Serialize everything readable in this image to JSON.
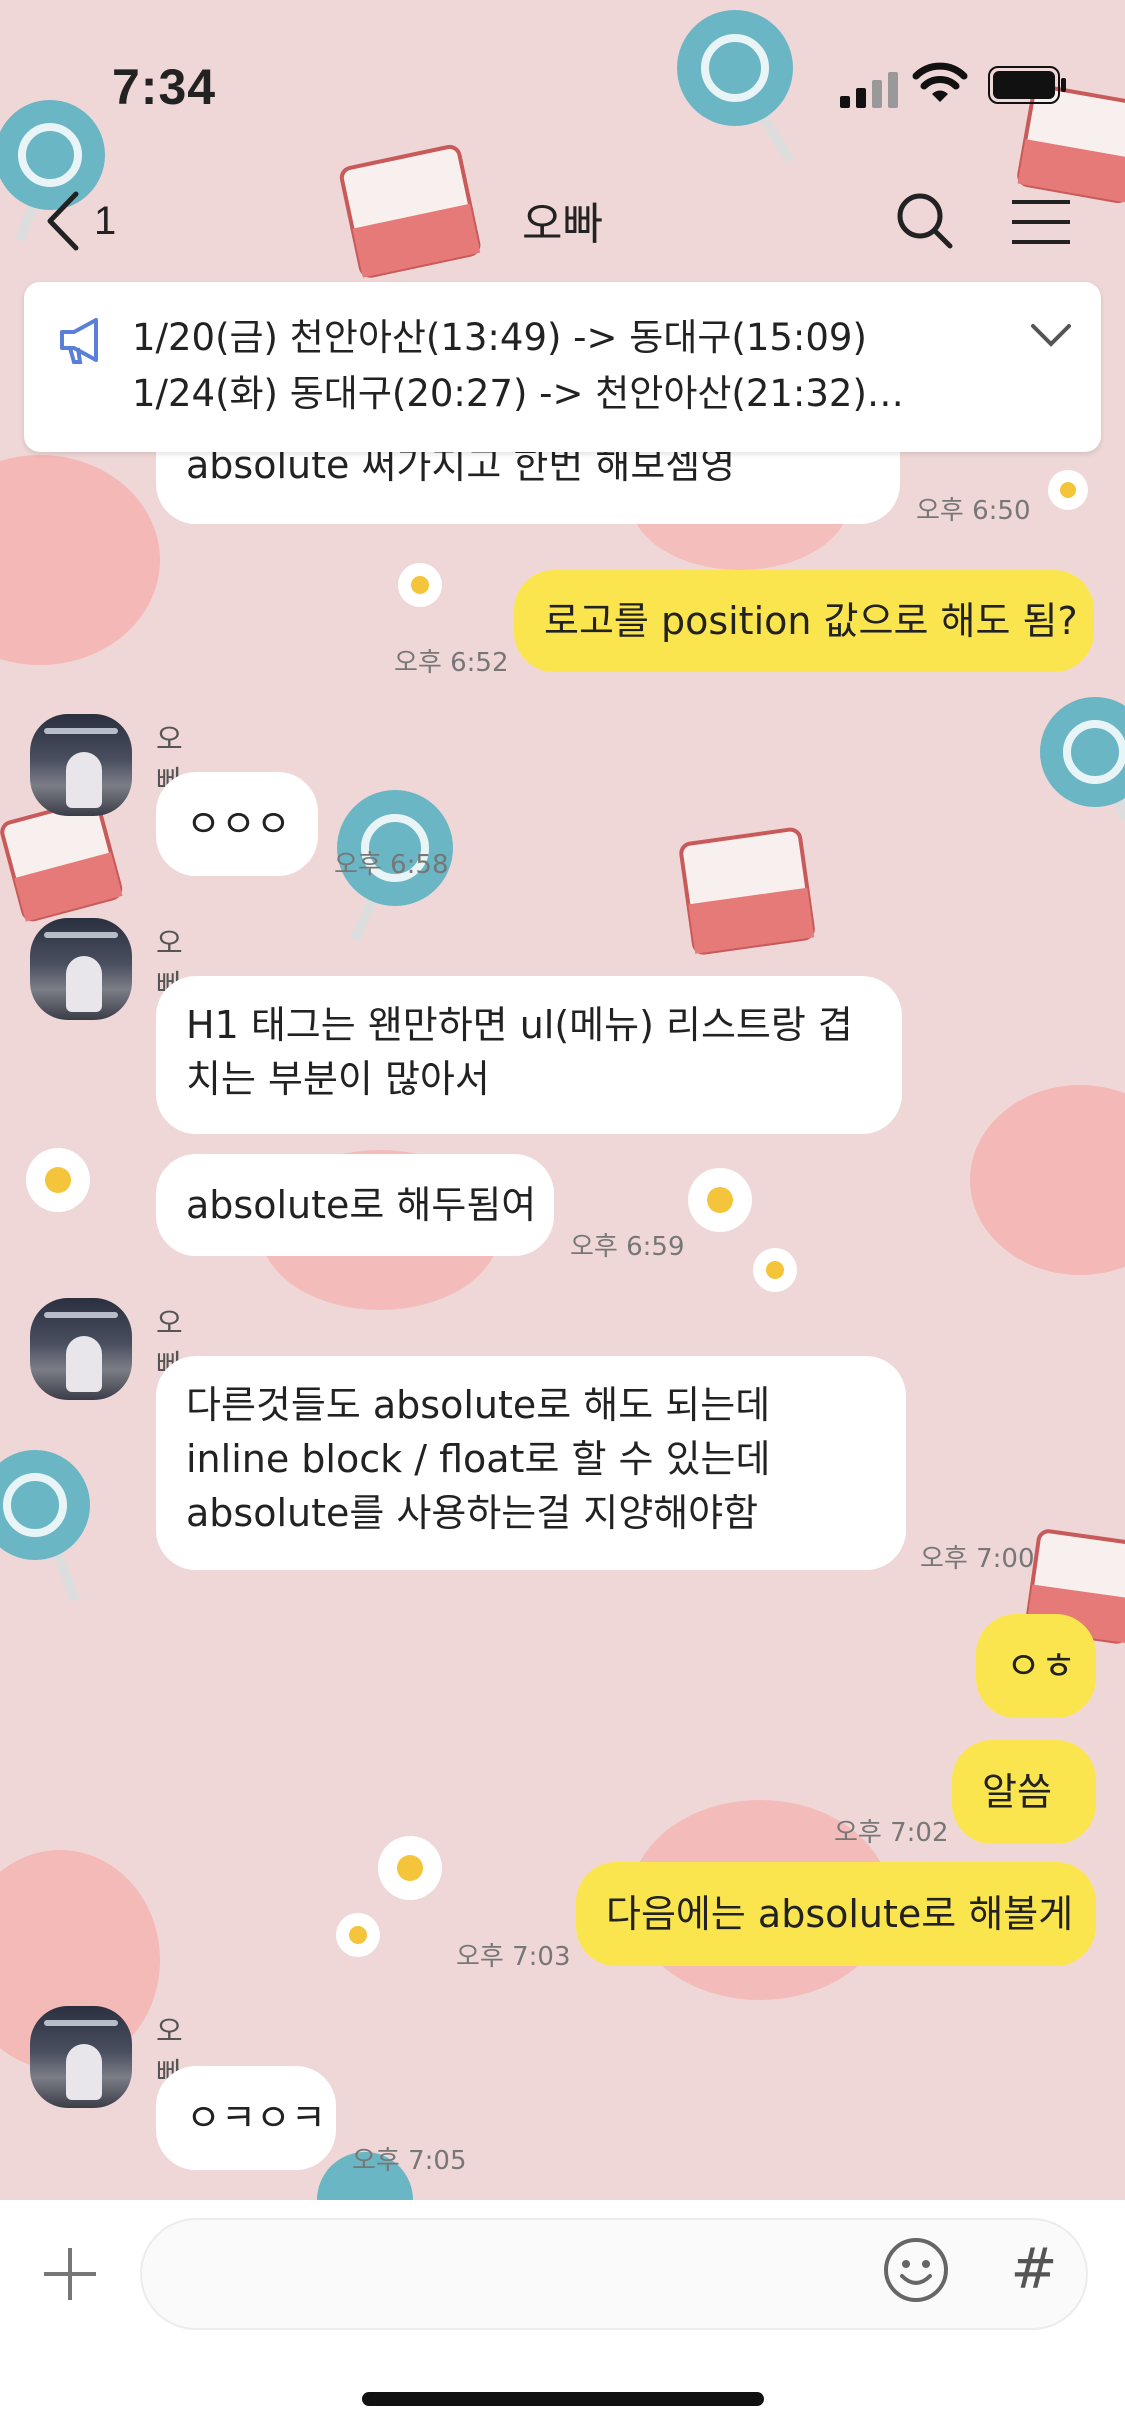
{
  "status_bar": {
    "time": "7:34"
  },
  "header": {
    "back_count": "1",
    "title": "오빠"
  },
  "notice": {
    "lines": [
      "1/20(금) 천안아산(13:49) -> 동대구(15:09)",
      "1/24(화) 동대구(20:27) -> 천안아산(21:32)…"
    ]
  },
  "messages": [
    {
      "text": "absolute 써가지고 한번 해보셈영",
      "time": "오후 6:50"
    },
    {
      "text": "로고를 position 값으로 해도 됨?",
      "time": "오후 6:52"
    },
    {
      "sender": "오빠",
      "text": "ㅇㅇㅇ",
      "time": "오후 6:58"
    },
    {
      "sender": "오빠",
      "text": "H1 태그는 왠만하면 ul(메뉴) 리스트랑 겹치는 부분이 많아서"
    },
    {
      "text": "absolute로 해두됨여",
      "time": "오후 6:59"
    },
    {
      "sender": "오빠",
      "text": "다른것들도 absolute로 해도 되는데 inline block / float로 할 수 있는데 absolute를 사용하는걸 지양해야함",
      "time": "오후 7:00"
    },
    {
      "text": "ㅇㅎ"
    },
    {
      "text": "알씀",
      "time": "오후 7:02"
    },
    {
      "text": "다음에는 absolute로 해볼게",
      "time": "오후 7:03"
    },
    {
      "sender": "오빠",
      "text": "ㅇㅋㅇㅋ",
      "time": "오후 7:05"
    }
  ],
  "input_bar": {
    "placeholder": ""
  },
  "colors": {
    "background": "#f0d7d7",
    "my_bubble": "#fbe54e",
    "their_bubble": "#ffffff"
  }
}
